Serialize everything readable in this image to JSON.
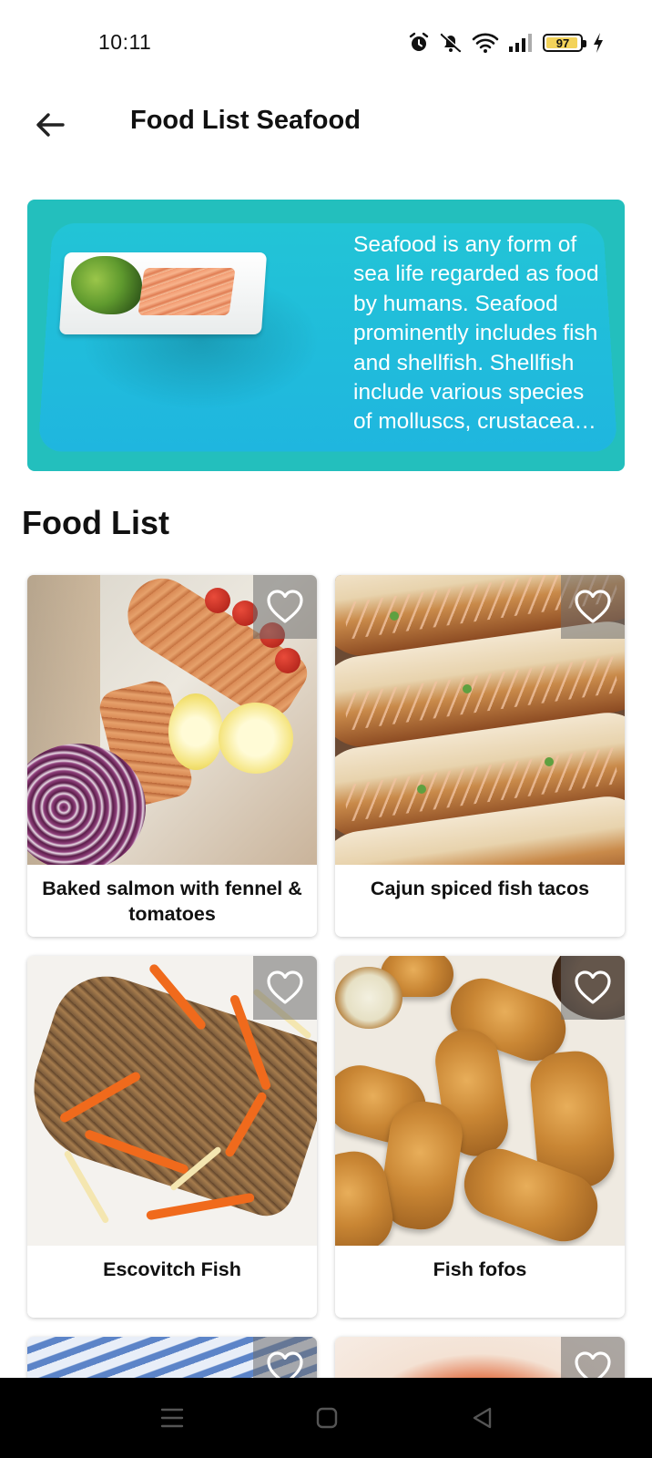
{
  "status_bar": {
    "time": "10:11",
    "battery_level": "97",
    "icons": [
      "alarm-icon",
      "mute-icon",
      "wifi-icon",
      "signal-icon",
      "battery-icon",
      "charging-icon"
    ]
  },
  "app_bar": {
    "title": "Food List Seafood",
    "back_icon": "arrow-left-icon"
  },
  "banner": {
    "description": "Seafood is any form of sea life regarded as food by humans. Seafood prominently includes fish and shellfish. Shellfish include various species of molluscs, crustaceans, and echinoderms."
  },
  "section": {
    "heading": "Food List"
  },
  "foods": [
    {
      "name": "Baked salmon with fennel & tomatoes",
      "favorite": false
    },
    {
      "name": "Cajun spiced fish tacos",
      "favorite": false
    },
    {
      "name": "Escovitch Fish",
      "favorite": false
    },
    {
      "name": "Fish fofos",
      "favorite": false
    }
  ],
  "nav_bar": {
    "icons": [
      "menu-icon",
      "home-icon",
      "back-triangle-icon"
    ]
  },
  "colors": {
    "banner_bg": "#23bfbd",
    "favorite_overlay": "#6e6e6e",
    "nav_bar": "#000000"
  }
}
